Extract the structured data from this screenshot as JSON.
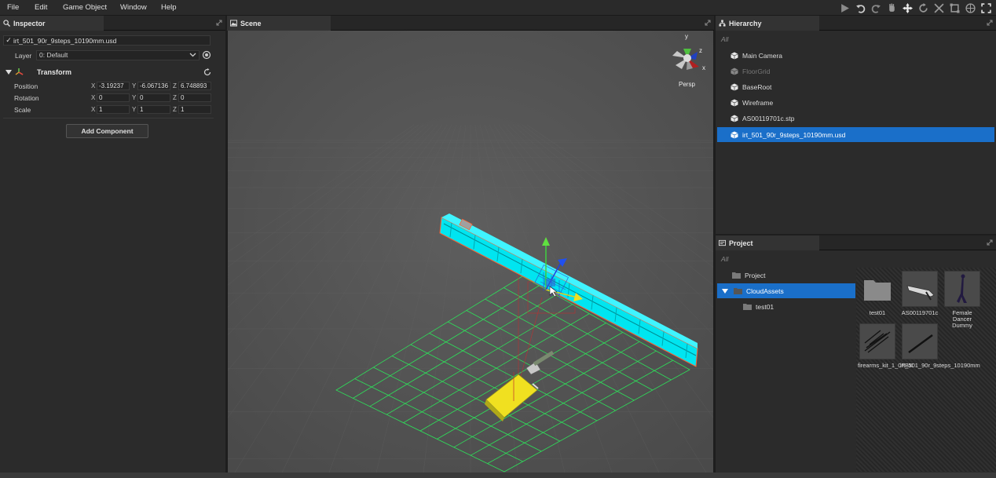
{
  "menu": [
    "File",
    "Edit",
    "Game Object",
    "Window",
    "Help"
  ],
  "toolbar_icons": [
    "play-icon",
    "undo-icon",
    "redo-icon",
    "hand-icon",
    "move-icon",
    "rotate-icon",
    "scale-icon",
    "rect-icon",
    "global-icon",
    "fullscreen-icon"
  ],
  "inspector": {
    "title": "Inspector",
    "object_name": "irt_501_90r_9steps_10190mm.usd",
    "layer_label": "Layer",
    "layer_value": "0: Default",
    "transform_label": "Transform",
    "position_label": "Position",
    "rotation_label": "Rotation",
    "scale_label": "Scale",
    "position": {
      "x": "-3.19237",
      "y": "-6.067136",
      "z": "6.748893"
    },
    "rotation": {
      "x": "0",
      "y": "0",
      "z": "0"
    },
    "scale": {
      "x": "1",
      "y": "1",
      "z": "1"
    },
    "add_component": "Add Component"
  },
  "scene": {
    "title": "Scene",
    "projection": "Persp",
    "gizmo_axes": {
      "x": "x",
      "y": "y",
      "z": "z"
    },
    "colors": {
      "background": "#555555",
      "grid": "#2ee05a",
      "selection": "#00e5f0",
      "gizmo_yellow": "#f0e020"
    }
  },
  "hierarchy": {
    "title": "Hierarchy",
    "filter": "All",
    "items": [
      {
        "label": "Main Camera"
      },
      {
        "label": "FloorGrid"
      },
      {
        "label": "BaseRoot"
      },
      {
        "label": "Wireframe"
      },
      {
        "label": "AS00119701c.stp"
      },
      {
        "label": "irt_501_90r_9steps_10190mm.usd"
      }
    ]
  },
  "project": {
    "title": "Project",
    "filter": "All",
    "tree": [
      {
        "label": "Project"
      },
      {
        "label": "CloudAssets"
      },
      {
        "label": "test01"
      }
    ],
    "assets": [
      {
        "label": "test01",
        "kind": "folder"
      },
      {
        "label": "AS00119701c",
        "kind": "model"
      },
      {
        "label": "Female Dancer Dummy",
        "kind": "model"
      },
      {
        "label": "firearms_kit_1_0FBX",
        "kind": "model"
      },
      {
        "label": "irt_501_90r_9steps_10190mm",
        "kind": "model"
      }
    ]
  }
}
